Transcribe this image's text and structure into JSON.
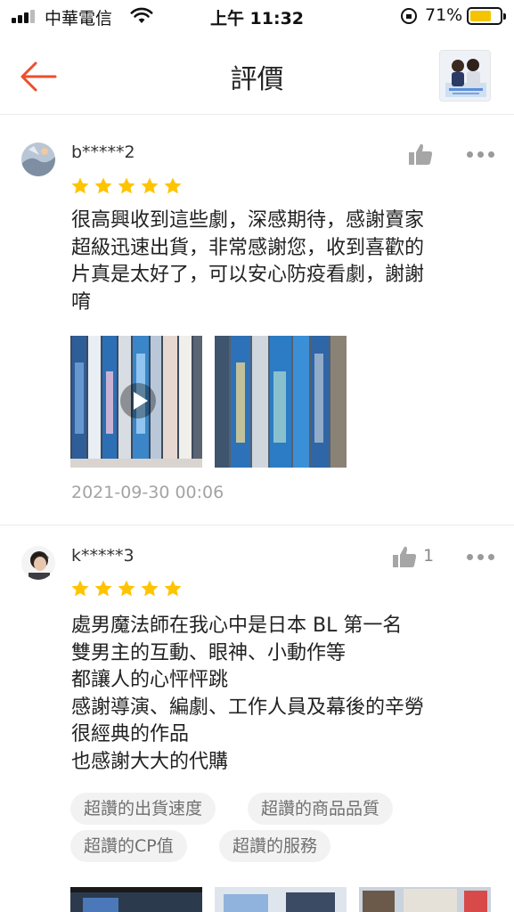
{
  "status_bar": {
    "carrier": "中華電信",
    "time": "上午 11:32",
    "battery_percent": "71%",
    "battery_level": 0.71,
    "icons": [
      "signal-icon",
      "wifi-icon",
      "orientation-lock-icon",
      "battery-icon"
    ]
  },
  "header": {
    "title": "評價",
    "back_icon": "arrow-left-icon",
    "accent_color": "#ee4d2d"
  },
  "star_color": "#ffc400",
  "reviews": [
    {
      "username": "b*****2",
      "rating": 5,
      "like_count": "",
      "text": "很高興收到這些劇，深感期待，感謝賣家\n超級迅速出貨，非常感謝您，收到喜歡的\n片真是太好了，可以安心防疫看劇，謝謝\n唷",
      "media": [
        "video",
        "photo"
      ],
      "date": "2021-09-30 00:06",
      "tags": []
    },
    {
      "username": "k*****3",
      "rating": 5,
      "like_count": "1",
      "text": "處男魔法師在我心中是日本 BL 第一名\n雙男主的互動、眼神、小動作等\n都讓人的心怦怦跳\n感謝導演、編劇、工作人員及幕後的辛勞\n很經典的作品\n也感謝大大的代購",
      "media": [
        "photo",
        "photo",
        "photo"
      ],
      "date": "",
      "tags": [
        "超讚的出貨速度",
        "超讚的商品品質",
        "超讚的CP值",
        "超讚的服務"
      ]
    }
  ]
}
